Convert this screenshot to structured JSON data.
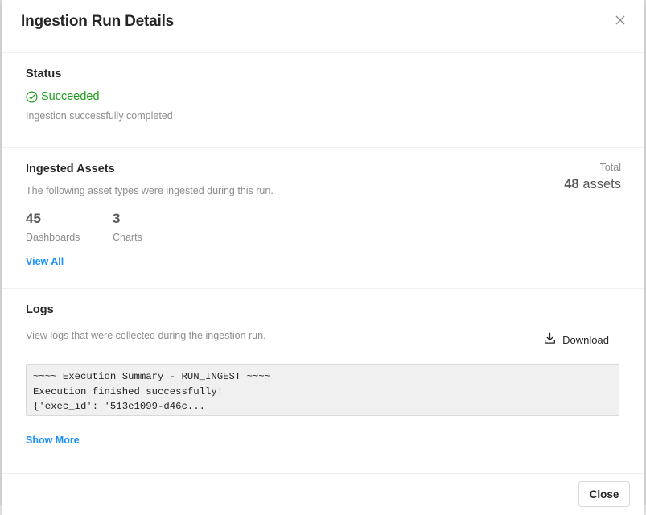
{
  "modal": {
    "title": "Ingestion Run Details",
    "close_icon": "close-icon"
  },
  "status": {
    "heading": "Status",
    "value": "Succeeded",
    "icon": "check-circle-icon",
    "description": "Ingestion successfully completed",
    "color": "#1f9d1f"
  },
  "assets": {
    "heading": "Ingested Assets",
    "description": "The following asset types were ingested during this run.",
    "total_label": "Total",
    "total_count": "48",
    "total_unit": "assets",
    "counts": [
      {
        "value": "45",
        "label": "Dashboards"
      },
      {
        "value": "3",
        "label": "Charts"
      }
    ],
    "view_all": "View All"
  },
  "logs": {
    "heading": "Logs",
    "description": "View logs that were collected during the ingestion run.",
    "download_label": "Download",
    "download_icon": "download-icon",
    "lines": [
      "~~~~ Execution Summary - RUN_INGEST ~~~~",
      "Execution finished successfully!",
      "{'exec_id': '513e1099-d46c..."
    ],
    "show_more": "Show More"
  },
  "footer": {
    "close_label": "Close"
  },
  "colors": {
    "link": "#1890ff",
    "success": "#1f9d1f"
  }
}
